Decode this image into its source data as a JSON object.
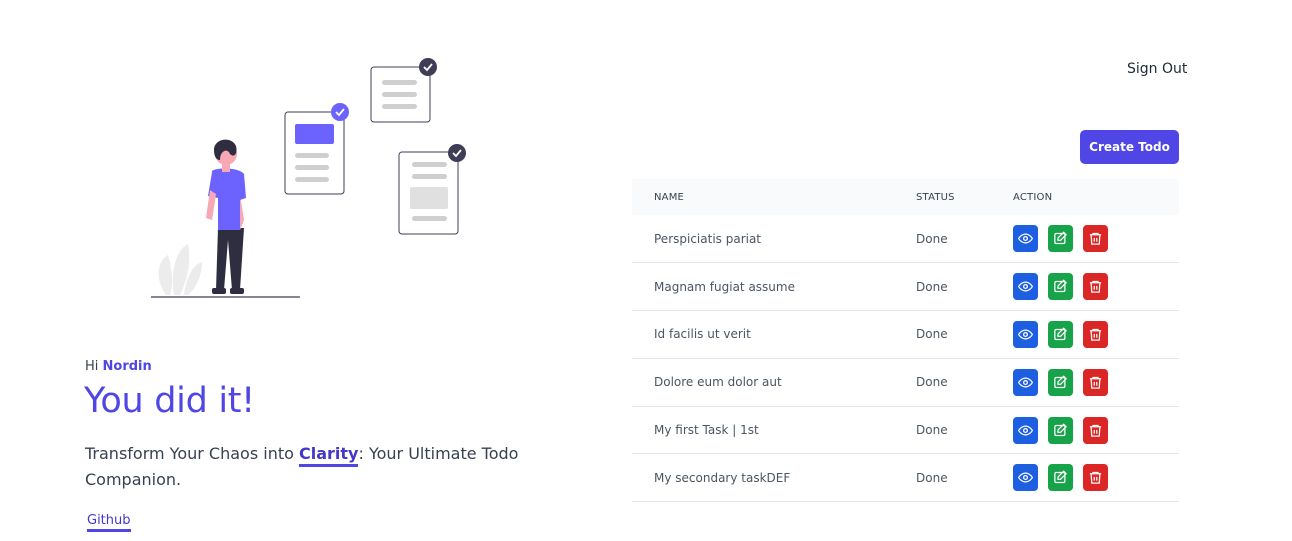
{
  "header": {
    "sign_out_label": "Sign Out"
  },
  "hero": {
    "greeting_prefix": "Hi",
    "user_name": "Nordin",
    "title": "You did it!",
    "tagline_before": "Transform Your Chaos into ",
    "tagline_highlight": "Clarity",
    "tagline_after": ": Your Ultimate Todo Companion.",
    "github_label": "Github"
  },
  "toolbar": {
    "create_label": "Create Todo"
  },
  "table": {
    "columns": {
      "name": "NAME",
      "status": "STATUS",
      "action": "ACTION"
    },
    "rows": [
      {
        "name": "Perspiciatis pariat",
        "status": "Done"
      },
      {
        "name": "Magnam fugiat assume",
        "status": "Done"
      },
      {
        "name": "Id facilis ut verit",
        "status": "Done"
      },
      {
        "name": "Dolore eum dolor aut",
        "status": "Done"
      },
      {
        "name": "My first Task | 1st",
        "status": "Done"
      },
      {
        "name": "My secondary taskDEF",
        "status": "Done"
      }
    ],
    "row_actions": [
      "eye-icon",
      "edit-icon",
      "trash-icon"
    ]
  },
  "colors": {
    "accent": "#4f46e5",
    "view": "#1d5fe0",
    "edit": "#16a34a",
    "delete": "#dc2626"
  },
  "icons": {
    "illustration": "person-with-checklists-illustration"
  }
}
